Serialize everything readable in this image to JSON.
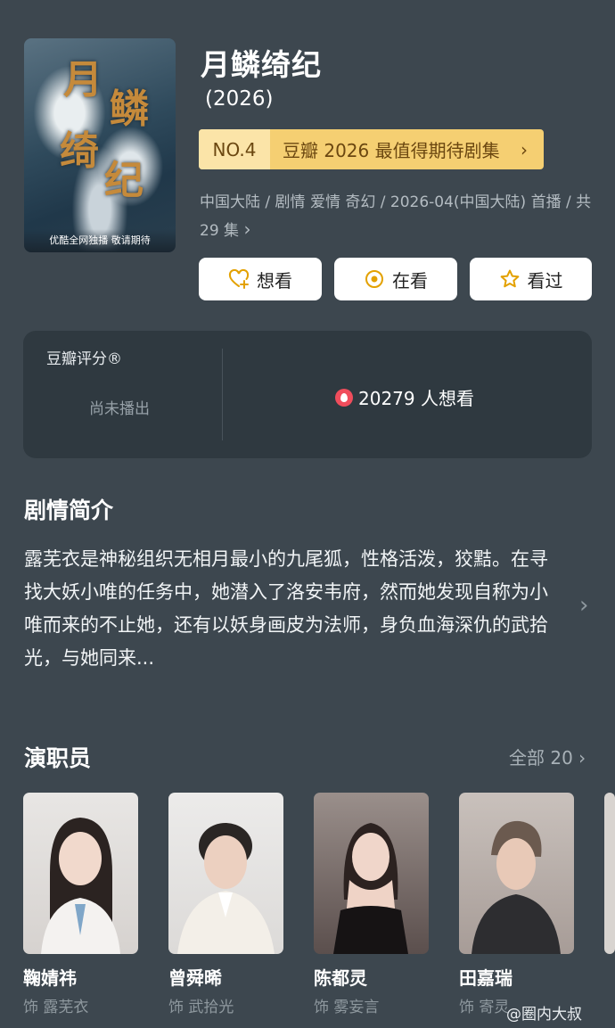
{
  "poster": {
    "title_chars": [
      "月",
      "鳞",
      "绮",
      "纪"
    ],
    "caption": "优酷全网独播 敬请期待"
  },
  "show": {
    "title": "月鳞绮纪",
    "year": "(2026)",
    "ranking": {
      "rank": "NO.4",
      "label": "豆瓣 2026 最值得期待剧集",
      "chevron": "›"
    },
    "meta": "中国大陆 / 剧情 爱情 奇幻 / 2026-04(中国大陆) 首播 / 共 29 集",
    "meta_chevron": "›"
  },
  "actions": [
    {
      "label": "想看",
      "icon": "heart-plus-icon"
    },
    {
      "label": "在看",
      "icon": "target-icon"
    },
    {
      "label": "看过",
      "icon": "star-icon"
    }
  ],
  "rating": {
    "label": "豆瓣评分®",
    "status": "尚未播出",
    "wish_count": "20279 人想看"
  },
  "synopsis": {
    "heading": "剧情简介",
    "text": "露芜衣是神秘组织无相月最小的九尾狐，性格活泼，狡黠。在寻找大妖小唯的任务中，她潜入了洛安韦府，然而她发现自称为小唯而来的不止她，还有以妖身画皮为法师，身负血海深仇的武拾光，与她同来...",
    "chevron": "›"
  },
  "cast": {
    "heading": "演职员",
    "all_label": "全部 20 ›",
    "members": [
      {
        "name": "鞠婧祎",
        "role": "饰 露芜衣"
      },
      {
        "name": "曾舜晞",
        "role": "饰 武拾光"
      },
      {
        "name": "陈都灵",
        "role": "饰 雾妄言"
      },
      {
        "name": "田嘉瑞",
        "role": "饰 寄灵"
      }
    ]
  },
  "watermark": "@圈内大叔",
  "colors": {
    "background": "#3d474f",
    "card": "#2f3940",
    "rank_badge": "#f5cf72",
    "wish_icon": "#f04d5c",
    "button_icon": "#e3a100"
  }
}
